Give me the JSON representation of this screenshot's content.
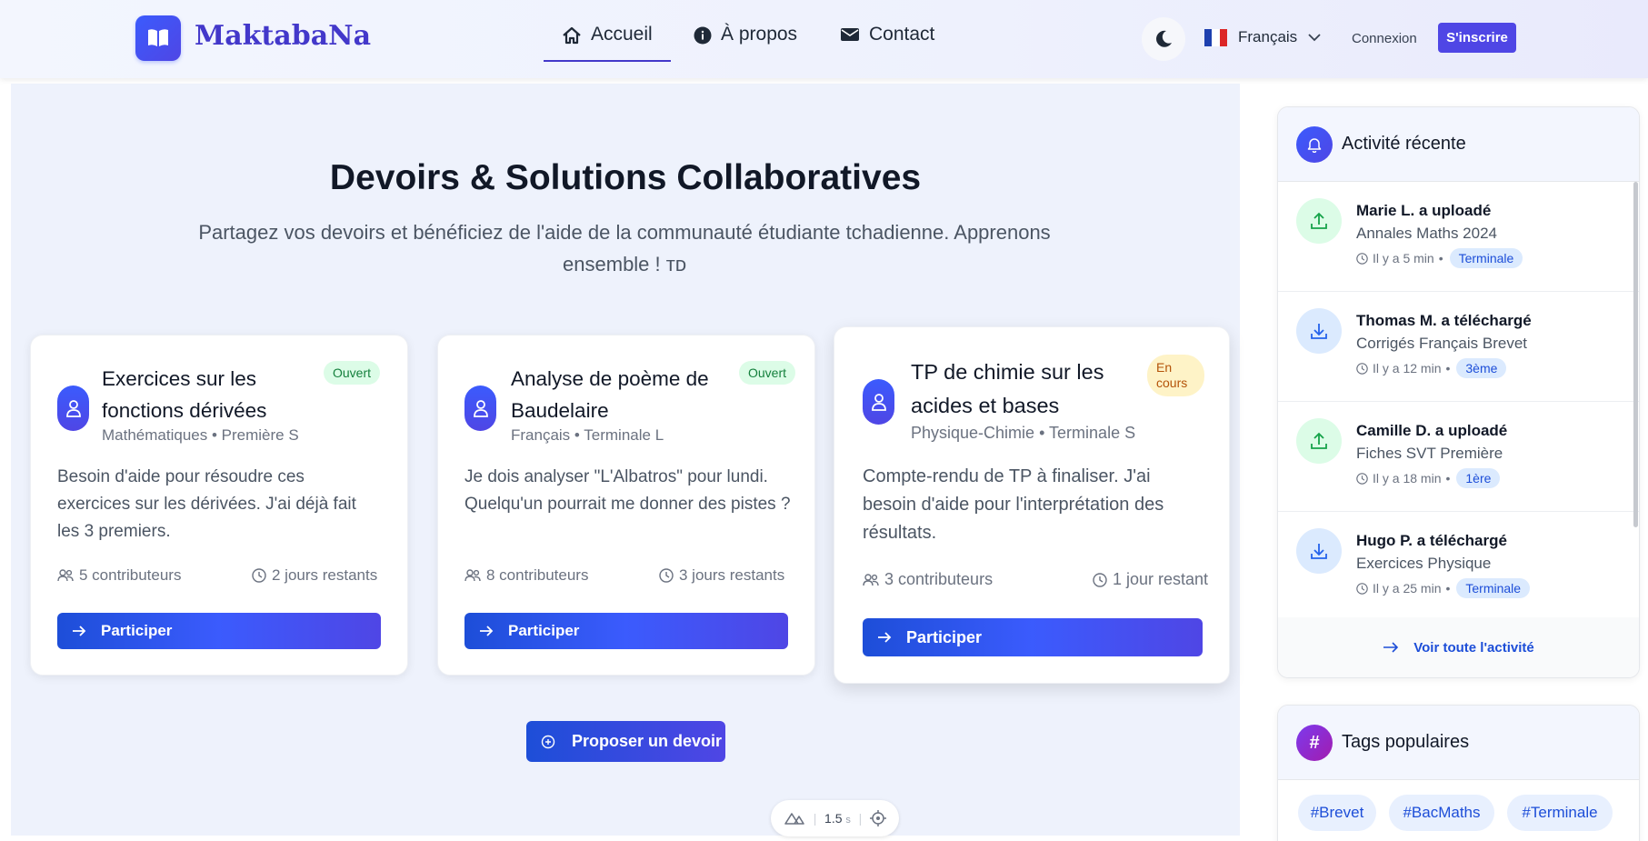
{
  "header": {
    "logo_text": "MaktabaNa",
    "nav": [
      {
        "label": "Accueil",
        "icon": "home-icon",
        "active": true
      },
      {
        "label": "À propos",
        "icon": "info-icon",
        "active": false
      },
      {
        "label": "Contact",
        "icon": "envelope-icon",
        "active": false
      }
    ],
    "language": "Français",
    "login": "Connexion",
    "signup": "S'inscrire"
  },
  "hero": {
    "title": "Devoirs & Solutions Collaboratives",
    "subtitle": "Partagez vos devoirs et bénéficiez de l'aide de la communauté étudiante tchadienne. Apprenons ensemble ! ᴛᴅ"
  },
  "assignments": [
    {
      "title": "Exercices sur les fonctions dérivées",
      "subject": "Mathématiques",
      "level": "Première S",
      "status": "Ouvert",
      "description": "Besoin d'aide pour résoudre ces exercices sur les dérivées. J'ai déjà fait les 3 premiers.",
      "contributors": "5 contributeurs",
      "remaining": "2 jours restants",
      "button": "Participer"
    },
    {
      "title": "Analyse de poème de Baudelaire",
      "subject": "Français",
      "level": "Terminale L",
      "status": "Ouvert",
      "description": "Je dois analyser \"L'Albatros\" pour lundi. Quelqu'un pourrait me donner des pistes ?",
      "contributors": "8 contributeurs",
      "remaining": "3 jours restants",
      "button": "Participer"
    },
    {
      "title": "TP de chimie sur les acides et bases",
      "subject": "Physique-Chimie",
      "level": "Terminale S",
      "status": "En cours",
      "description": "Compte-rendu de TP à finaliser. J'ai besoin d'aide pour l'interprétation des résultats.",
      "contributors": "3 contributeurs",
      "remaining": "1 jour restant",
      "button": "Participer"
    }
  ],
  "propose_button": "Proposer un devoir",
  "devbar": {
    "time": "1.5",
    "unit": "s"
  },
  "activity": {
    "title": "Activité récente",
    "items": [
      {
        "who": "Marie L. a uploadé",
        "what": "Annales Maths 2024",
        "time": "Il y a 5 min",
        "level": "Terminale",
        "type": "upload"
      },
      {
        "who": "Thomas M. a téléchargé",
        "what": "Corrigés Français Brevet",
        "time": "Il y a 12 min",
        "level": "3ème",
        "type": "download"
      },
      {
        "who": "Camille D. a uploadé",
        "what": "Fiches SVT Première",
        "time": "Il y a 18 min",
        "level": "1ère",
        "type": "upload"
      },
      {
        "who": "Hugo P. a téléchargé",
        "what": "Exercices Physique",
        "time": "Il y a 25 min",
        "level": "Terminale",
        "type": "download"
      }
    ],
    "see_all": "Voir toute l'activité"
  },
  "tags": {
    "title": "Tags populaires",
    "items": [
      "#Brevet",
      "#BacMaths",
      "#Terminale"
    ]
  },
  "colors": {
    "primary": "#4f46e5",
    "accent_blue": "#1d4ed8",
    "open_green": "#15803d",
    "in_progress": "#b45309"
  }
}
